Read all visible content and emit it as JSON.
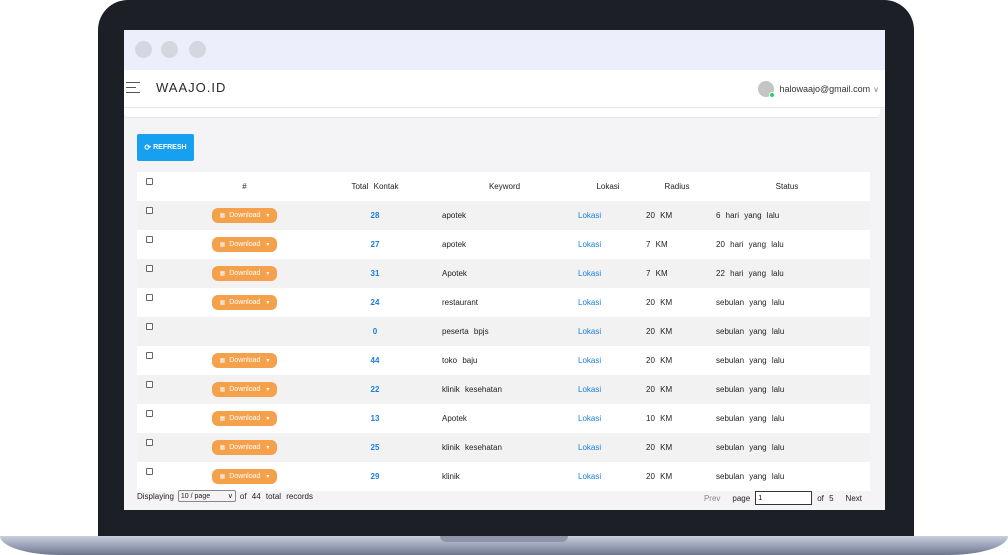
{
  "brand": "WAAJO.ID",
  "user": {
    "email": "halowaajo@gmail.com"
  },
  "toolbar": {
    "refresh_label": "REFRESH"
  },
  "table": {
    "headers": {
      "num": "#",
      "total": "Total Kontak",
      "keyword": "Keyword",
      "lokasi": "Lokasi",
      "radius": "Radius",
      "status": "Status"
    },
    "download_label": "Download",
    "rows": [
      {
        "has_download": true,
        "total": "28",
        "keyword": "apotek",
        "lokasi": "Lokasi",
        "radius": "20 KM",
        "status": "6 hari yang lalu"
      },
      {
        "has_download": true,
        "total": "27",
        "keyword": "apotek",
        "lokasi": "Lokasi",
        "radius": "7 KM",
        "status": "20 hari yang lalu"
      },
      {
        "has_download": true,
        "total": "31",
        "keyword": "Apotek",
        "lokasi": "Lokasi",
        "radius": "7 KM",
        "status": "22 hari yang lalu"
      },
      {
        "has_download": true,
        "total": "24",
        "keyword": "restaurant",
        "lokasi": "Lokasi",
        "radius": "20 KM",
        "status": "sebulan yang lalu"
      },
      {
        "has_download": false,
        "total": "0",
        "keyword": "peserta bpjs",
        "lokasi": "Lokasi",
        "radius": "20 KM",
        "status": "sebulan yang lalu"
      },
      {
        "has_download": true,
        "total": "44",
        "keyword": "toko baju",
        "lokasi": "Lokasi",
        "radius": "20 KM",
        "status": "sebulan yang lalu"
      },
      {
        "has_download": true,
        "total": "22",
        "keyword": "klinik kesehatan",
        "lokasi": "Lokasi",
        "radius": "20 KM",
        "status": "sebulan yang lalu"
      },
      {
        "has_download": true,
        "total": "13",
        "keyword": "Apotek",
        "lokasi": "Lokasi",
        "radius": "10 KM",
        "status": "sebulan yang lalu"
      },
      {
        "has_download": true,
        "total": "25",
        "keyword": "klinik kesehatan",
        "lokasi": "Lokasi",
        "radius": "20 KM",
        "status": "sebulan yang lalu"
      },
      {
        "has_download": true,
        "total": "29",
        "keyword": "klinik",
        "lokasi": "Lokasi",
        "radius": "20 KM",
        "status": "sebulan yang lalu"
      }
    ]
  },
  "footer": {
    "displaying": "Displaying",
    "per_page": "10 / page",
    "of_records": "of 44 total records",
    "prev": "Prev",
    "page_label": "page",
    "page_value": "1",
    "of_pages": "of 5",
    "next": "Next"
  },
  "colors": {
    "accent": "#18a0f0",
    "download": "#f5a04a",
    "link": "#1a7fd8"
  }
}
